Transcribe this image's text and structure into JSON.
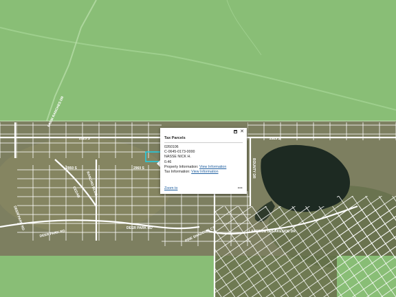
{
  "popup": {
    "title": "Tax Parcels",
    "parcel_id": "0260106",
    "parcel_number": "C-0645-0173-0000",
    "owner": "NASSE NICK H.",
    "acres": "0.46",
    "property_label": "Property Information:",
    "property_link": "View Information",
    "tax_label": "Tax Information:",
    "tax_link": "View Information",
    "zoom_label": "Zoom to",
    "more_label": "•••",
    "maximize_icon": "maximize-icon",
    "close_icon": "close-icon"
  },
  "roads": {
    "r1": "2925 S",
    "r2": "2925 S",
    "r3": "2950 S",
    "r4": "2960 S",
    "r5": "DEER PARK RD",
    "r6": "DEER PARK RD",
    "r7": "DEER PARK RD",
    "r8": "LAKESIDE DR",
    "r9": "LAKESIDE DR",
    "r10": "BOUNTY DR",
    "r11": "PINE SHADOWS CT",
    "r12": "RANCHO BLUE",
    "r13": "FARM RANCHES DR",
    "r14": "CEDAR"
  },
  "colors": {
    "grass_overlay": "#8cc57a",
    "parcel_line": "#ffffff",
    "selected_parcel": "#20d0e8",
    "lake": "#1d2a22",
    "link": "#1f5fa0"
  }
}
